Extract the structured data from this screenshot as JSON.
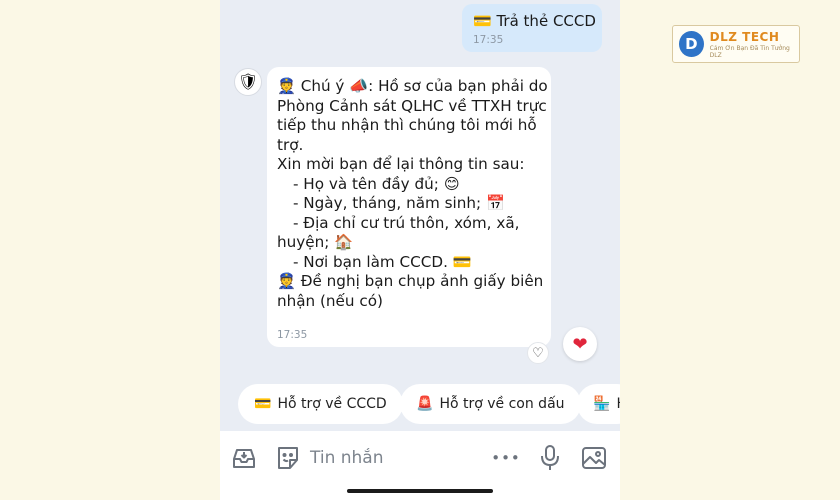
{
  "watermark": {
    "brand": "DLZ TECH",
    "tagline": "Cảm Ơn Bạn Đã Tin Tưởng DLZ",
    "mark": "D"
  },
  "sent_message": {
    "icon": "💳",
    "text": "Trả thẻ CCCD",
    "time": "17:35"
  },
  "received_message": {
    "avatar": "🛡",
    "lines": [
      "👮 Chú ý 📣: Hồ sơ của bạn phải do",
      "Phòng Cảnh sát QLHC về TTXH trực",
      "tiếp thu nhận thì chúng tôi mới hỗ",
      "trợ.",
      "Xin mời bạn để lại thông tin sau:",
      "- Họ và tên đầy đủ; 😊",
      "- Ngày, tháng, năm sinh; 📅",
      "- Địa chỉ cư trú thôn, xóm, xã,",
      "huyện; 🏠",
      "- Nơi bạn làm CCCD. 💳",
      "👮 Đề nghị bạn chụp ảnh giấy biên",
      "nhận (nếu có)"
    ],
    "time": "17:35"
  },
  "reactions": {
    "empty_heart": "♡",
    "heart": "❤"
  },
  "quick_replies": [
    {
      "icon": "💳",
      "label": "Hỗ trợ về CCCD"
    },
    {
      "icon": "🚨",
      "label": "Hỗ trợ về con dấu"
    },
    {
      "icon": "🏪",
      "label": "H"
    }
  ],
  "composer": {
    "placeholder": "Tin nhắn",
    "more": "•••"
  }
}
